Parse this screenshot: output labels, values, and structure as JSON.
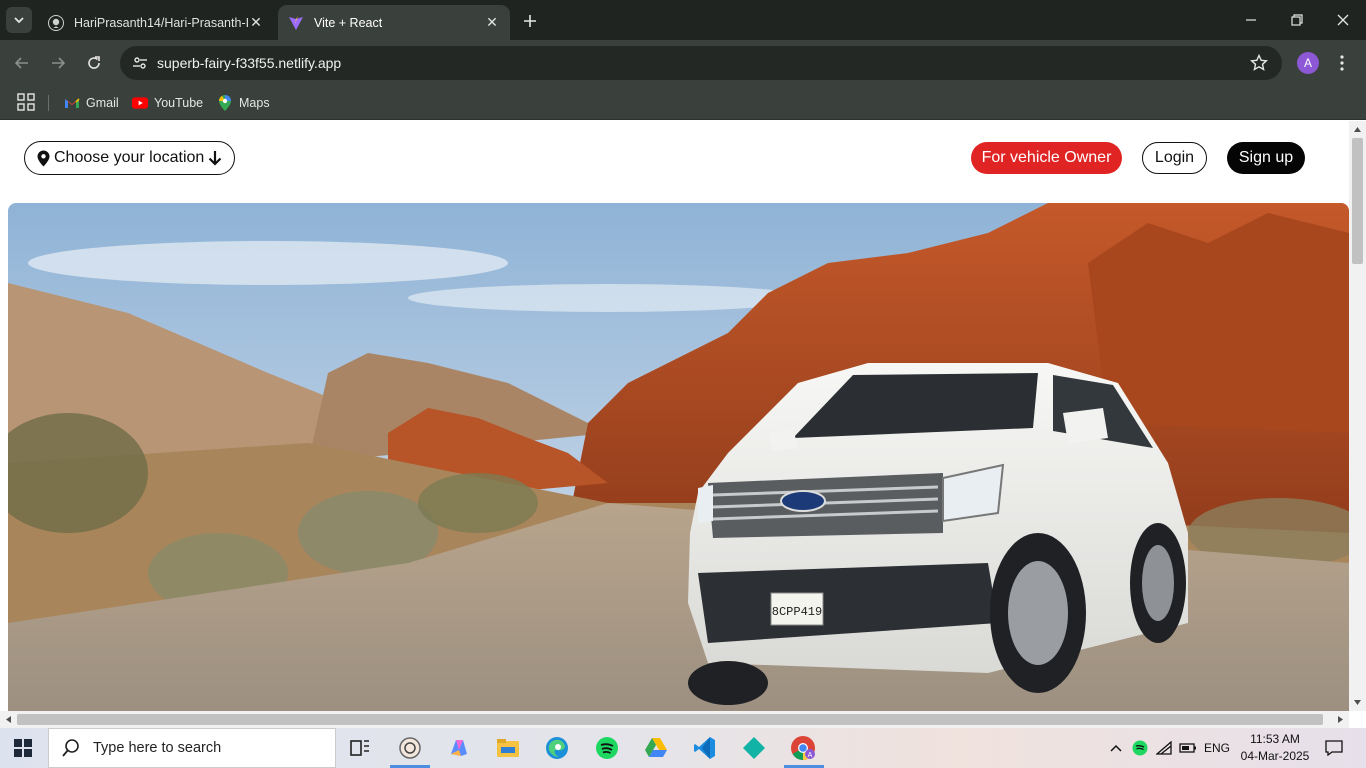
{
  "browser": {
    "tabs": [
      {
        "title": "HariPrasanth14/Hari-Prasanth-I",
        "icon": "github-icon",
        "active": false
      },
      {
        "title": "Vite + React",
        "icon": "vite-icon",
        "active": true
      }
    ],
    "url": "superb-fairy-f33f55.netlify.app",
    "profile_initial": "A",
    "bookmarks": [
      {
        "label": "Gmail",
        "icon": "gmail-icon"
      },
      {
        "label": "YouTube",
        "icon": "youtube-icon"
      },
      {
        "label": "Maps",
        "icon": "maps-icon"
      }
    ]
  },
  "header": {
    "location_button": "Choose your location",
    "owner_button": "For vehicle Owner",
    "login_button": "Login",
    "signup_button": "Sign up"
  },
  "hero": {
    "image": "white Ford SUV parked on a gravel road among red rock desert canyons",
    "plate": "8CPP419"
  },
  "colors": {
    "accent_red": "#e02424",
    "black_button": "#050505",
    "browser_dark": "#1f2420",
    "browser_toolbar": "#3a403b"
  },
  "taskbar": {
    "search_placeholder": "Type here to search",
    "apps": [
      "task-view-icon",
      "app-icon",
      "copilot-icon",
      "file-explorer-icon",
      "edge-icon",
      "spotify-icon",
      "google-drive-icon",
      "vscode-icon",
      "app-diamond-icon",
      "chrome-icon"
    ],
    "language": "ENG",
    "time": "11:53 AM",
    "date": "04-Mar-2025"
  }
}
